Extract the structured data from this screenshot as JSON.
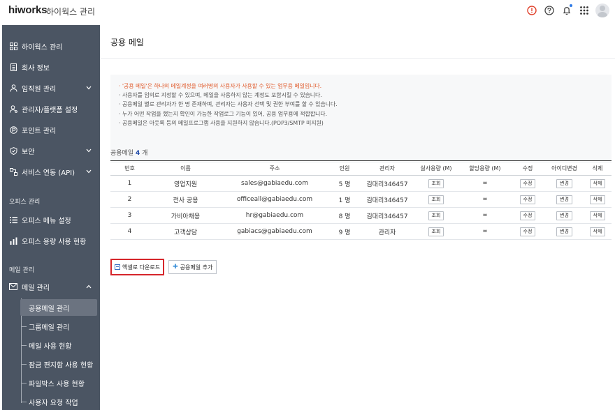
{
  "header": {
    "logo": "hiworks",
    "subtitle": "하이웍스 관리",
    "icons": [
      "alert-icon",
      "help-icon",
      "bell-icon",
      "apps-grid-icon",
      "avatar"
    ],
    "alert_color": "#e0402a"
  },
  "sidebar": {
    "items": [
      {
        "label": "하이웍스 관리",
        "icon": "grid-icon",
        "chevron": false
      },
      {
        "label": "회사 정보",
        "icon": "building-icon",
        "chevron": false
      },
      {
        "label": "임직원 관리",
        "icon": "person-icon",
        "chevron": true
      },
      {
        "label": "관리자/플랫폼 설정",
        "icon": "admin-icon",
        "chevron": false
      },
      {
        "label": "포인트 관리",
        "icon": "point-icon",
        "chevron": false
      },
      {
        "label": "보안",
        "icon": "shield-icon",
        "chevron": true
      },
      {
        "label": "서비스 연동 (API)",
        "icon": "link-icon",
        "chevron": true
      }
    ],
    "office_group": "오피스 관리",
    "office_items": [
      {
        "label": "오피스 메뉴 설정",
        "icon": "list-icon"
      },
      {
        "label": "오피스 용량 사용 현황",
        "icon": "chart-icon"
      }
    ],
    "mail_group": "메일 관리",
    "mail_item": {
      "label": "메일 관리",
      "icon": "mail-icon"
    },
    "mail_sub": [
      "공용메일 관리",
      "그룹메일 관리",
      "메일 사용 현황",
      "잠금 편지함 사용 현황",
      "파일박스 사용 현황",
      "사용자 요청 작업"
    ],
    "active_sub": 0
  },
  "main": {
    "title": "공용 메일",
    "notices": [
      {
        "text": "'공용 메일'은 하나의 메일계정을 여러명의 사용자가 사용할 수 있는 업무용 메일입니다.",
        "warn": true
      },
      {
        "text": "사용자를 임의로 지정할 수 있으며, 메일을 사용하지 않는 계정도 포함시킬 수 있습니다.",
        "warn": false
      },
      {
        "text": "공용메일 별로 관리자가 한 명 존재하며, 관리자는 사용자 선택 및 권한 부여를 할 수 있습니다.",
        "warn": false
      },
      {
        "text": "누가 어떤 작업을 했는지 확인이 가능한 작업로그 기능이 있어, 공용 업무용에 적합합니다.",
        "warn": false
      },
      {
        "text": "공용메일은 아웃룩 등의 메일프로그램 사용을 지원하지 않습니다.(POP3/SMTP 미지원)",
        "warn": false
      }
    ],
    "count_label": "공용메일",
    "count_value": "4",
    "count_unit": "개",
    "columns": [
      "번호",
      "이름",
      "주소",
      "인원",
      "관리자",
      "실사용량 (M)",
      "할당용량 (M)",
      "수정",
      "아이디변경",
      "삭제"
    ],
    "rows": [
      {
        "no": "1",
        "name": "영업지원",
        "address": "sales@gabiaedu.com",
        "members": "5 명",
        "admin": "김대리346457",
        "usage": "조회",
        "quota": "∞",
        "edit": "수정",
        "change_id": "변경",
        "delete": "삭제"
      },
      {
        "no": "2",
        "name": "전사 공용",
        "address": "officeall@gabiaedu.com",
        "members": "1 명",
        "admin": "김대리346457",
        "usage": "조회",
        "quota": "∞",
        "edit": "수정",
        "change_id": "변경",
        "delete": "삭제"
      },
      {
        "no": "3",
        "name": "가비아채용",
        "address": "hr@gabiaedu.com",
        "members": "8 명",
        "admin": "김대리346457",
        "usage": "조회",
        "quota": "∞",
        "edit": "수정",
        "change_id": "변경",
        "delete": "삭제"
      },
      {
        "no": "4",
        "name": "고객상담",
        "address": "gabiacs@gabiaedu.com",
        "members": "9 명",
        "admin": "관리자",
        "usage": "조회",
        "quota": "∞",
        "edit": "수정",
        "change_id": "변경",
        "delete": "삭제"
      }
    ],
    "excel_button": "엑셀로 다운로드",
    "add_button": "공용메일 추가"
  },
  "colors": {
    "sidebar": "#4b5563",
    "accent": "#1f4aa8",
    "warn": "#e05a2b",
    "highlight": "#d6262b"
  }
}
